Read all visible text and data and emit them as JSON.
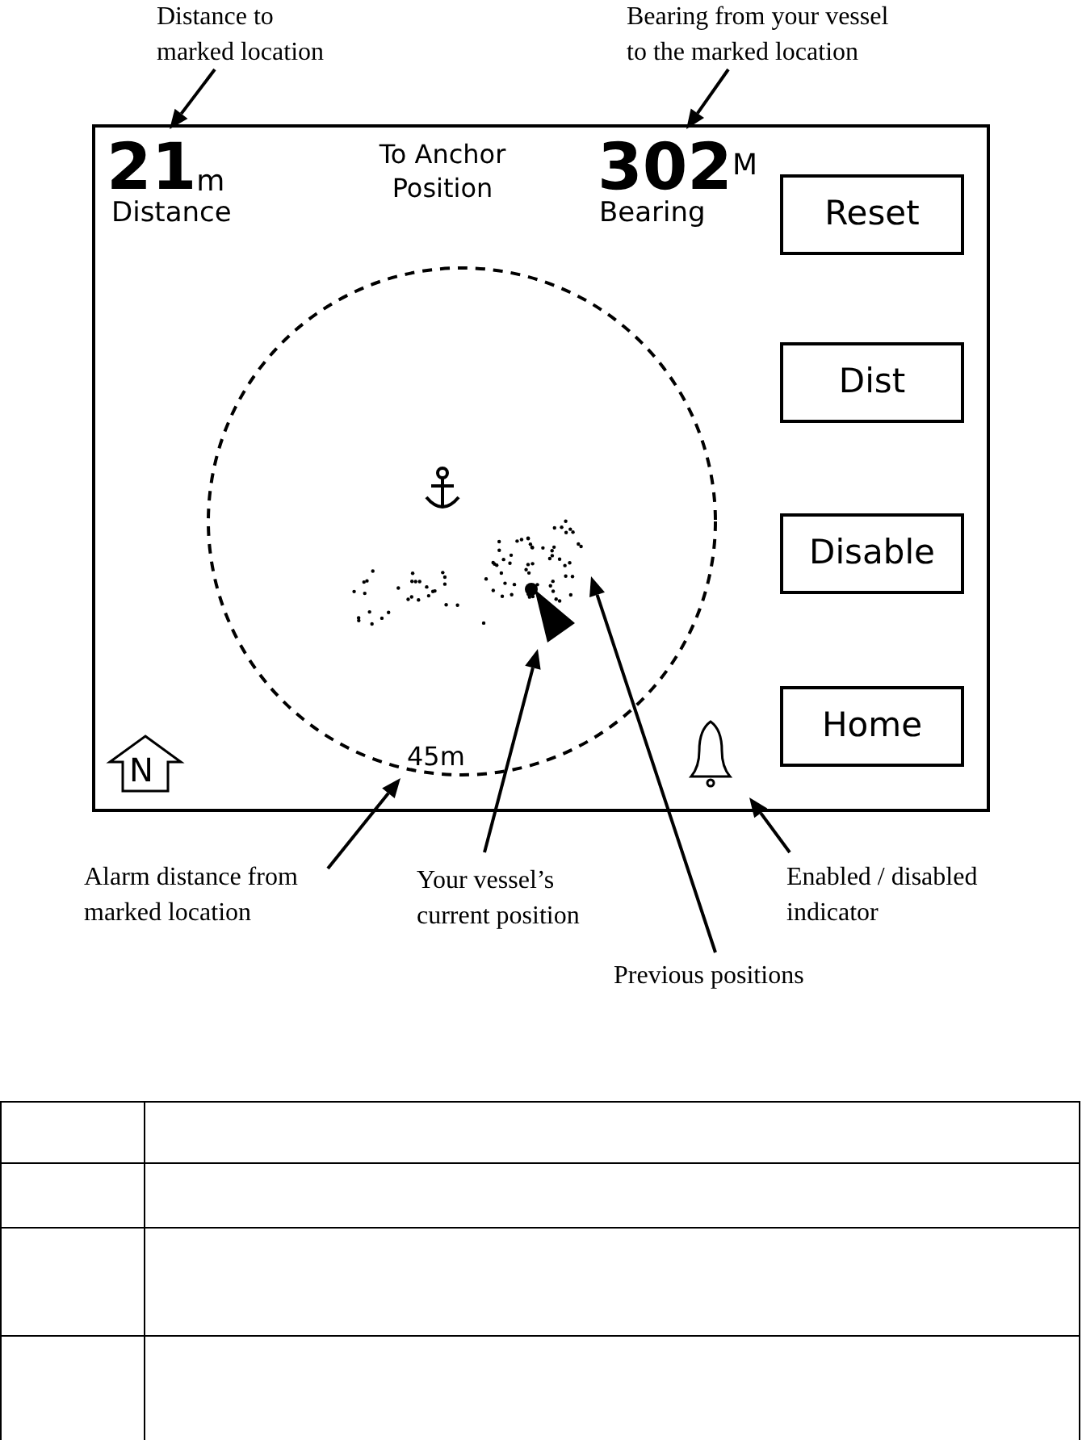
{
  "annotations_top": [
    {
      "text": "Distance to\nmarked location"
    },
    {
      "text": "Bearing from your vessel\nto the marked location"
    }
  ],
  "screen": {
    "title": "To Anchor\nPosition",
    "distance": {
      "value": "21",
      "unit": "m",
      "label": "Distance"
    },
    "bearing": {
      "value": "302",
      "unit": "M",
      "label": "Bearing"
    },
    "buttons": [
      "Reset",
      "Dist",
      "Disable",
      "Home"
    ],
    "north_label": "N",
    "alarm_radius": "45m"
  },
  "annotations_bottom": [
    {
      "text": "Alarm distance from\nmarked location"
    },
    {
      "text": "Your vessel’s\ncurrent position"
    },
    {
      "text": "Enabled / disabled\nindicator"
    },
    {
      "text": "Previous positions"
    }
  ]
}
